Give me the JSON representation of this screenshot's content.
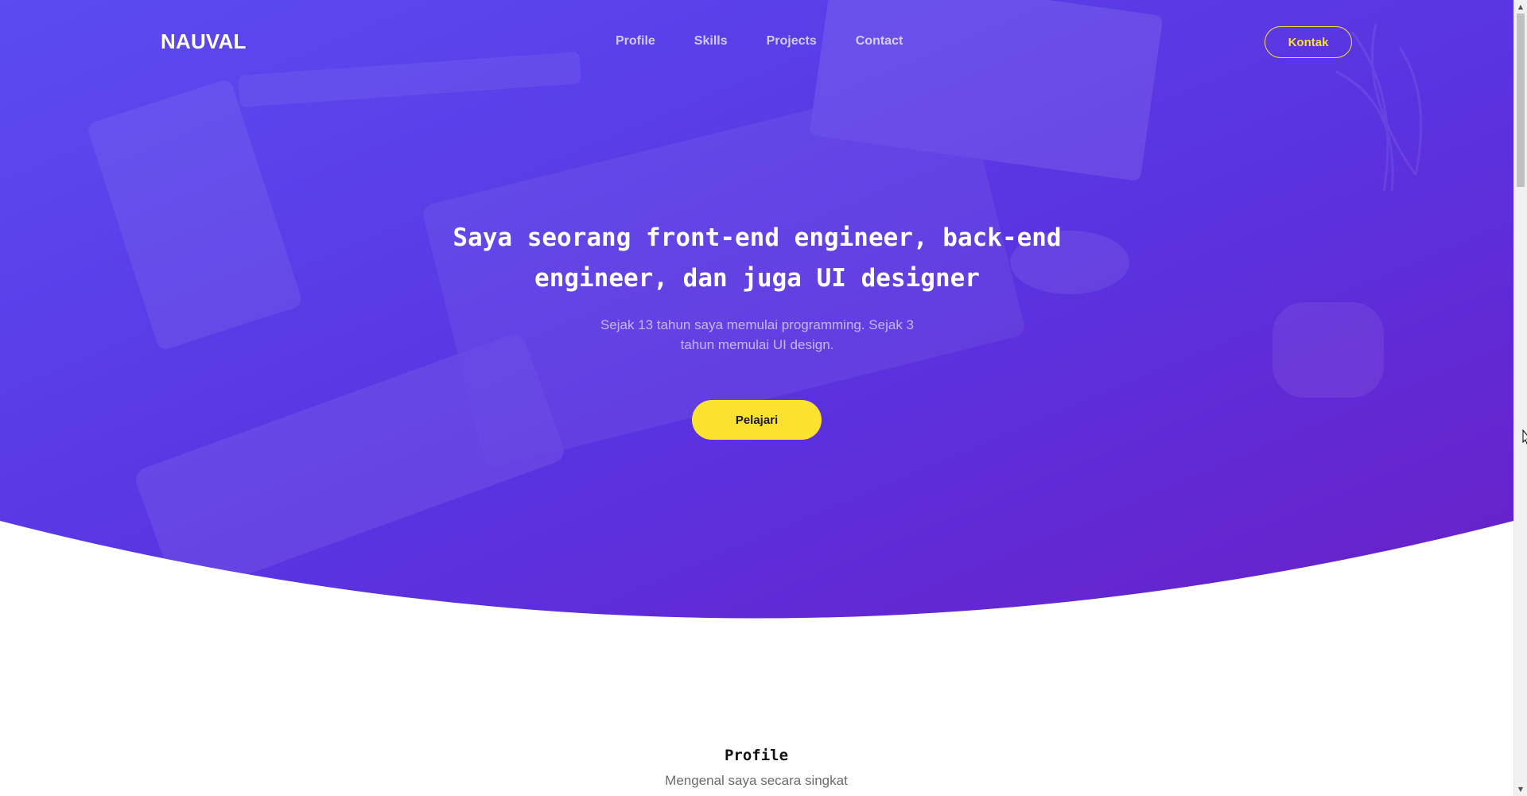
{
  "navbar": {
    "brand": "NAUVAL",
    "links": [
      {
        "label": "Profile"
      },
      {
        "label": "Skills"
      },
      {
        "label": "Projects"
      },
      {
        "label": "Contact"
      }
    ],
    "cta_label": "Kontak"
  },
  "hero": {
    "title": "Saya seorang front-end engineer, back-end engineer, dan juga UI designer",
    "subtitle": "Sejak 13 tahun saya memulai programming. Sejak 3 tahun memulai UI design.",
    "button_label": "Pelajari"
  },
  "profile": {
    "title": "Profile",
    "subtitle": "Mengenal saya secara singkat"
  },
  "colors": {
    "hero_gradient_start": "#5a48ef",
    "hero_gradient_end": "#6a22c8",
    "accent_yellow": "#fbe22e",
    "page_background": "#ffffff"
  },
  "icons": {
    "scroll_up": "scroll-up-arrow-icon",
    "scroll_down": "scroll-down-arrow-icon",
    "cursor": "mouse-cursor-icon"
  }
}
